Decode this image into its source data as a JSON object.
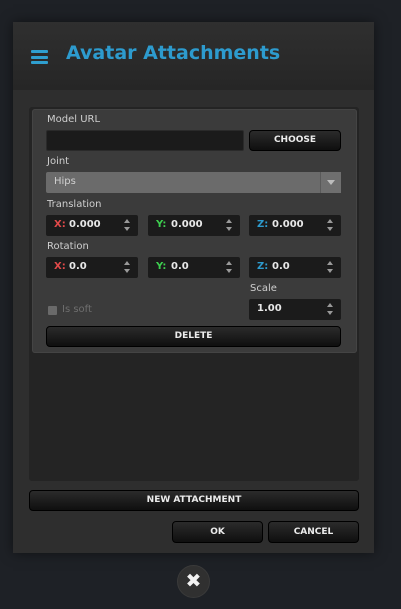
{
  "header": {
    "title": "Avatar Attachments",
    "menu_icon": "hamburger-menu-icon"
  },
  "attachment": {
    "model_url_label": "Model URL",
    "model_url_value": "",
    "choose_label": "CHOOSE",
    "joint_label": "Joint",
    "joint_value": "Hips",
    "translation_label": "Translation",
    "translation": {
      "x_axis": "X:",
      "x": "0.000",
      "y_axis": "Y:",
      "y": "0.000",
      "z_axis": "Z:",
      "z": "0.000"
    },
    "rotation_label": "Rotation",
    "rotation": {
      "x_axis": "X:",
      "x": "0.0",
      "y_axis": "Y:",
      "y": "0.0",
      "z_axis": "Z:",
      "z": "0.0"
    },
    "is_soft_label": "Is soft",
    "is_soft_checked": false,
    "scale_label": "Scale",
    "scale_value": "1.00",
    "delete_label": "DELETE"
  },
  "footer": {
    "new_attachment_label": "NEW ATTACHMENT",
    "ok_label": "OK",
    "cancel_label": "CANCEL"
  },
  "close_button": {
    "glyph": "✖"
  },
  "colors": {
    "accent": "#2d9bce",
    "axis_x": "#e34a4a",
    "axis_y": "#3dcf4f",
    "axis_z": "#2d9bce"
  }
}
